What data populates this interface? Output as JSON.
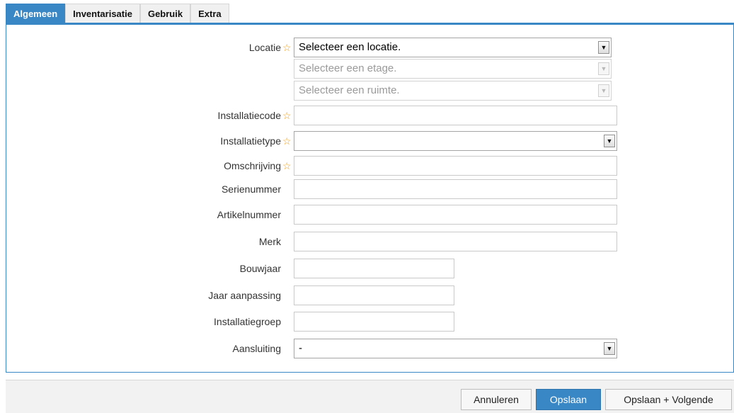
{
  "tabs": [
    {
      "label": "Algemeen",
      "active": true
    },
    {
      "label": "Inventarisatie",
      "active": false
    },
    {
      "label": "Gebruik",
      "active": false
    },
    {
      "label": "Extra",
      "active": false
    }
  ],
  "form": {
    "locatie": {
      "label": "Locatie",
      "required": true,
      "value": "Selecteer een locatie."
    },
    "etage": {
      "placeholder": "Selecteer een etage.",
      "disabled": true
    },
    "ruimte": {
      "placeholder": "Selecteer een ruimte.",
      "disabled": true
    },
    "installatiecode": {
      "label": "Installatiecode",
      "required": true,
      "value": ""
    },
    "installatietype": {
      "label": "Installatietype",
      "required": true,
      "value": ""
    },
    "omschrijving": {
      "label": "Omschrijving",
      "required": true,
      "value": ""
    },
    "serienummer": {
      "label": "Serienummer",
      "value": ""
    },
    "artikelnummer": {
      "label": "Artikelnummer",
      "value": ""
    },
    "merk": {
      "label": "Merk",
      "value": ""
    },
    "bouwjaar": {
      "label": "Bouwjaar",
      "value": ""
    },
    "jaar_aanpassing": {
      "label": "Jaar aanpassing",
      "value": ""
    },
    "installatiegroep": {
      "label": "Installatiegroep",
      "value": ""
    },
    "aansluiting": {
      "label": "Aansluiting",
      "value": "-"
    }
  },
  "icons": {
    "required": "star-icon",
    "dropdown": "dropdown-arrow-icon"
  },
  "buttons": {
    "cancel": "Annuleren",
    "save": "Opslaan",
    "save_next": "Opslaan + Volgende"
  },
  "colors": {
    "accent": "#3a87c6",
    "required_star": "#f0a020"
  }
}
